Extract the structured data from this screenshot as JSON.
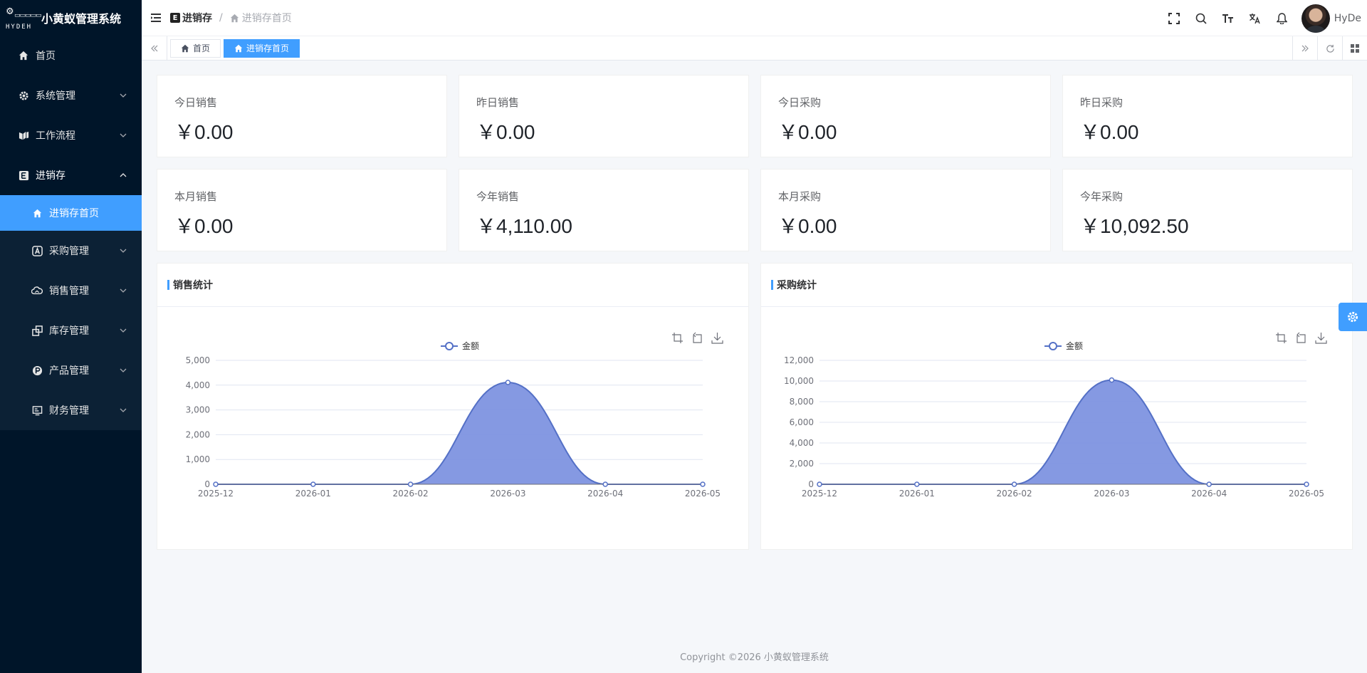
{
  "app": {
    "title": "小黄蚁管理系统",
    "logo_tag": "HYDEH"
  },
  "sidebar": {
    "items": [
      {
        "label": "首页",
        "icon": "home-icon"
      },
      {
        "label": "系统管理",
        "icon": "gear-icon"
      },
      {
        "label": "工作流程",
        "icon": "workflow-icon"
      },
      {
        "label": "进销存",
        "icon": "inventory-icon",
        "expanded": true
      }
    ],
    "sub_items": [
      {
        "label": "进销存首页",
        "icon": "home-icon",
        "active": true
      },
      {
        "label": "采购管理",
        "icon": "purchase-icon"
      },
      {
        "label": "销售管理",
        "icon": "cloud-icon"
      },
      {
        "label": "库存管理",
        "icon": "warehouse-icon"
      },
      {
        "label": "产品管理",
        "icon": "product-icon"
      },
      {
        "label": "财务管理",
        "icon": "finance-icon"
      }
    ]
  },
  "header": {
    "breadcrumb": [
      "进销存",
      "进销存首页"
    ],
    "username": "HyDe",
    "icons": [
      "fullscreen-icon",
      "search-icon",
      "font-size-icon",
      "translate-icon",
      "bell-icon"
    ]
  },
  "tabs": [
    {
      "label": "首页",
      "active": false
    },
    {
      "label": "进销存首页",
      "active": true
    }
  ],
  "stats": [
    {
      "label": "今日销售",
      "value": "￥0.00"
    },
    {
      "label": "昨日销售",
      "value": "￥0.00"
    },
    {
      "label": "今日采购",
      "value": "￥0.00"
    },
    {
      "label": "昨日采购",
      "value": "￥0.00"
    },
    {
      "label": "本月销售",
      "value": "￥0.00"
    },
    {
      "label": "今年销售",
      "value": "￥4,110.00"
    },
    {
      "label": "本月采购",
      "value": "￥0.00"
    },
    {
      "label": "今年采购",
      "value": "￥10,092.50"
    }
  ],
  "panels": [
    {
      "title": "销售统计"
    },
    {
      "title": "采购统计"
    }
  ],
  "chart_data": [
    {
      "type": "area",
      "title": "销售统计",
      "categories": [
        "2025-12",
        "2026-01",
        "2026-02",
        "2026-03",
        "2026-04",
        "2026-05"
      ],
      "series": [
        {
          "name": "金额",
          "values": [
            0,
            0,
            0,
            4110,
            0,
            0
          ]
        }
      ],
      "ylim": [
        0,
        5000
      ],
      "yticks": [
        0,
        1000,
        2000,
        3000,
        4000,
        5000
      ],
      "ytick_labels": [
        "0",
        "1,000",
        "2,000",
        "3,000",
        "4,000",
        "5,000"
      ],
      "smooth": true,
      "grid": true,
      "legend": "top-center",
      "color": "#5470c6"
    },
    {
      "type": "area",
      "title": "采购统计",
      "categories": [
        "2025-12",
        "2026-01",
        "2026-02",
        "2026-03",
        "2026-04",
        "2026-05"
      ],
      "series": [
        {
          "name": "金额",
          "values": [
            0,
            0,
            0,
            10092.5,
            0,
            0
          ]
        }
      ],
      "ylim": [
        0,
        12000
      ],
      "yticks": [
        0,
        2000,
        4000,
        6000,
        8000,
        10000,
        12000
      ],
      "ytick_labels": [
        "0",
        "2,000",
        "4,000",
        "6,000",
        "8,000",
        "10,000",
        "12,000"
      ],
      "smooth": true,
      "grid": true,
      "legend": "top-center",
      "color": "#5470c6"
    }
  ],
  "footer": {
    "text": "Copyright ©2026 小黄蚁管理系统"
  }
}
